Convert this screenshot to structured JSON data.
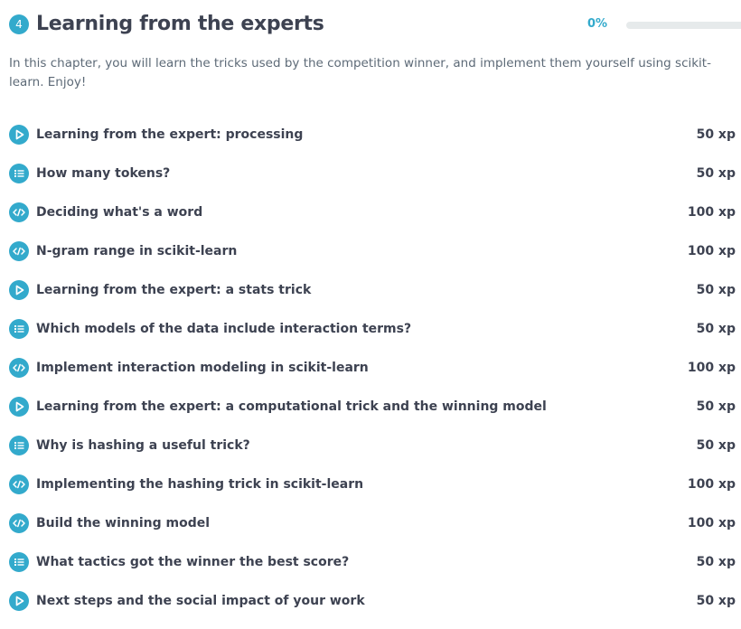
{
  "chapter": {
    "number": "4",
    "title": "Learning from the experts",
    "progress_label": "0%",
    "progress_value": 0,
    "accent_color": "#33aacc",
    "description": "In this chapter, you will learn the tricks used by the competition winner, and implement them yourself using scikit-learn. Enjoy!"
  },
  "exercises": [
    {
      "title": "Learning from the expert: processing",
      "xp": "50 xp",
      "icon": "video-play-icon"
    },
    {
      "title": "How many tokens?",
      "xp": "50 xp",
      "icon": "multiple-choice-icon"
    },
    {
      "title": "Deciding what's a word",
      "xp": "100 xp",
      "icon": "code-icon"
    },
    {
      "title": "N-gram range in scikit-learn",
      "xp": "100 xp",
      "icon": "code-icon"
    },
    {
      "title": "Learning from the expert: a stats trick",
      "xp": "50 xp",
      "icon": "video-play-icon"
    },
    {
      "title": "Which models of the data include interaction terms?",
      "xp": "50 xp",
      "icon": "multiple-choice-icon"
    },
    {
      "title": "Implement interaction modeling in scikit-learn",
      "xp": "100 xp",
      "icon": "code-icon"
    },
    {
      "title": "Learning from the expert: a computational trick and the winning model",
      "xp": "50 xp",
      "icon": "video-play-icon"
    },
    {
      "title": "Why is hashing a useful trick?",
      "xp": "50 xp",
      "icon": "multiple-choice-icon"
    },
    {
      "title": "Implementing the hashing trick in scikit-learn",
      "xp": "100 xp",
      "icon": "code-icon"
    },
    {
      "title": "Build the winning model",
      "xp": "100 xp",
      "icon": "code-icon"
    },
    {
      "title": "What tactics got the winner the best score?",
      "xp": "50 xp",
      "icon": "multiple-choice-icon"
    },
    {
      "title": "Next steps and the social impact of your work",
      "xp": "50 xp",
      "icon": "video-play-icon"
    }
  ]
}
